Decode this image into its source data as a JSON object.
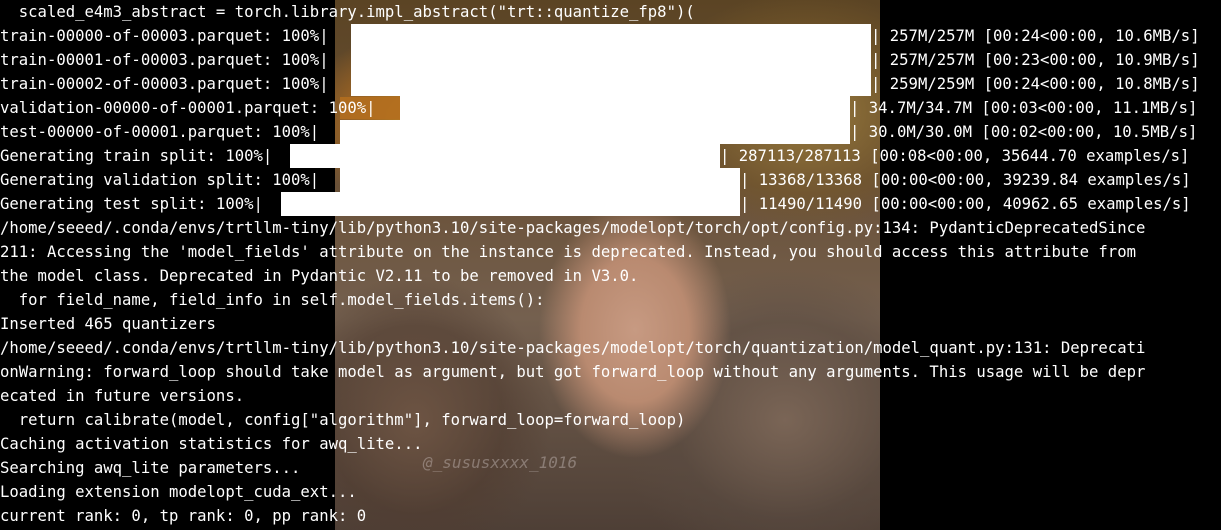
{
  "wallpaper": {
    "watermark": "@_sususxxxx_1016"
  },
  "terminal": {
    "lines": [
      "  scaled_e4m3_abstract = torch.library.impl_abstract(\"trt::quantize_fp8\")(",
      "train-00000-of-00003.parquet: 100%|",
      "| 257M/257M [00:24<00:00, 10.6MB/s]",
      "train-00001-of-00003.parquet: 100%|",
      "| 257M/257M [00:23<00:00, 10.9MB/s]",
      "train-00002-of-00003.parquet: 100%|",
      "| 259M/259M [00:24<00:00, 10.8MB/s]",
      "validation-00000-of-00001.parquet: 100%|",
      "| 34.7M/34.7M [00:03<00:00, 11.1MB/s]",
      "test-00000-of-00001.parquet: 100%|",
      "| 30.0M/30.0M [00:02<00:00, 10.5MB/s]",
      "Generating train split: 100%|",
      "| 287113/287113 [00:08<00:00, 35644.70 examples/s]",
      "Generating validation split: 100%|",
      "| 13368/13368 [00:00<00:00, 39239.84 examples/s]",
      "Generating test split: 100%|",
      "| 11490/11490 [00:00<00:00, 40962.65 examples/s]",
      "/home/seeed/.conda/envs/trtllm-tiny/lib/python3.10/site-packages/modelopt/torch/opt/config.py:134: PydanticDeprecatedSince",
      "211: Accessing the 'model_fields' attribute on the instance is deprecated. Instead, you should access this attribute from",
      "the model class. Deprecated in Pydantic V2.11 to be removed in V3.0.",
      "  for field_name, field_info in self.model_fields.items():",
      "Inserted 465 quantizers",
      "/home/seeed/.conda/envs/trtllm-tiny/lib/python3.10/site-packages/modelopt/torch/quantization/model_quant.py:131: Deprecati",
      "onWarning: forward_loop should take model as argument, but got forward_loop without any arguments. This usage will be depr",
      "ecated in future versions.",
      "  return calibrate(model, config[\"algorithm\"], forward_loop=forward_loop)",
      "Caching activation statistics for awq_lite...",
      "Searching awq_lite parameters...",
      "Loading extension modelopt_cuda_ext...",
      "current rank: 0, tp rank: 0, pp rank: 0"
    ],
    "progress": [
      {
        "label": "train-00000-of-00003.parquet",
        "percent": 100
      },
      {
        "label": "train-00001-of-00003.parquet",
        "percent": 100
      },
      {
        "label": "train-00002-of-00003.parquet",
        "percent": 100
      },
      {
        "label": "validation-00000-of-00001.parquet",
        "percent": 100
      },
      {
        "label": "test-00000-of-00001.parquet",
        "percent": 100
      },
      {
        "label": "Generating train split",
        "percent": 100
      },
      {
        "label": "Generating validation split",
        "percent": 100
      },
      {
        "label": "Generating test split",
        "percent": 100
      }
    ]
  }
}
